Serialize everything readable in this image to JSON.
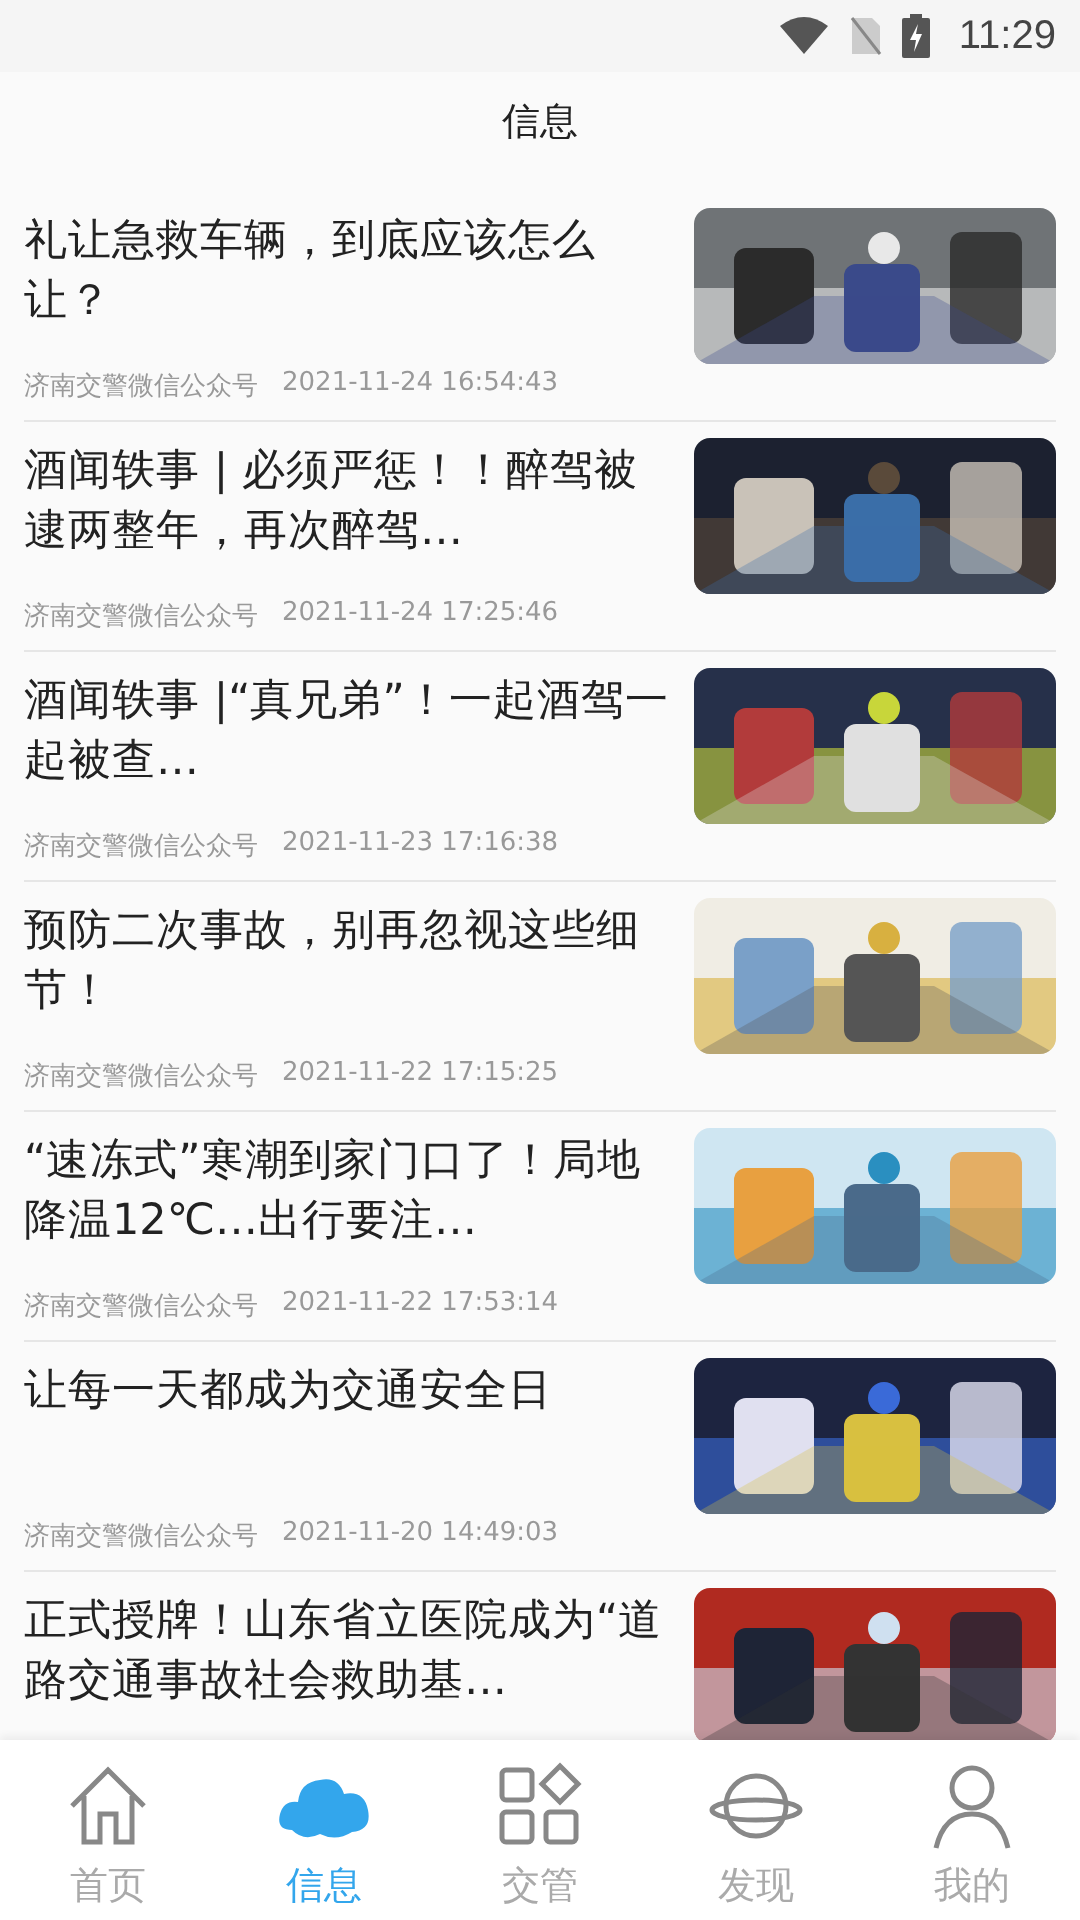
{
  "status_bar": {
    "time": "11:29"
  },
  "header": {
    "title": "信息"
  },
  "articles": [
    {
      "title": "礼让急救车辆，到底应该怎么让？",
      "source": "济南交警微信公众号",
      "time": "2021-11-24 16:54:43"
    },
    {
      "title": "酒闻轶事 | 必须严惩！！醉驾被逮两整年，再次醉驾…",
      "source": "济南交警微信公众号",
      "time": "2021-11-24 17:25:46"
    },
    {
      "title": "酒闻轶事 |“真兄弟”！一起酒驾一起被查…",
      "source": "济南交警微信公众号",
      "time": "2021-11-23 17:16:38"
    },
    {
      "title": "预防二次事故，别再忽视这些细节！",
      "source": "济南交警微信公众号",
      "time": "2021-11-22 17:15:25"
    },
    {
      "title": "“速冻式”寒潮到家门口了！局地降温12℃…出行要注…",
      "source": "济南交警微信公众号",
      "time": "2021-11-22 17:53:14"
    },
    {
      "title": "让每一天都成为交通安全日",
      "source": "济南交警微信公众号",
      "time": "2021-11-20 14:49:03"
    },
    {
      "title": "正式授牌！山东省立医院成为“道路交通事故社会救助基…"
    }
  ],
  "nav": [
    {
      "label": "首页",
      "kind": "home",
      "selected": false
    },
    {
      "label": "信息",
      "kind": "cloud",
      "selected": true
    },
    {
      "label": "交管",
      "kind": "grid",
      "selected": false
    },
    {
      "label": "发现",
      "kind": "planet",
      "selected": false
    },
    {
      "label": "我的",
      "kind": "person",
      "selected": false
    }
  ]
}
